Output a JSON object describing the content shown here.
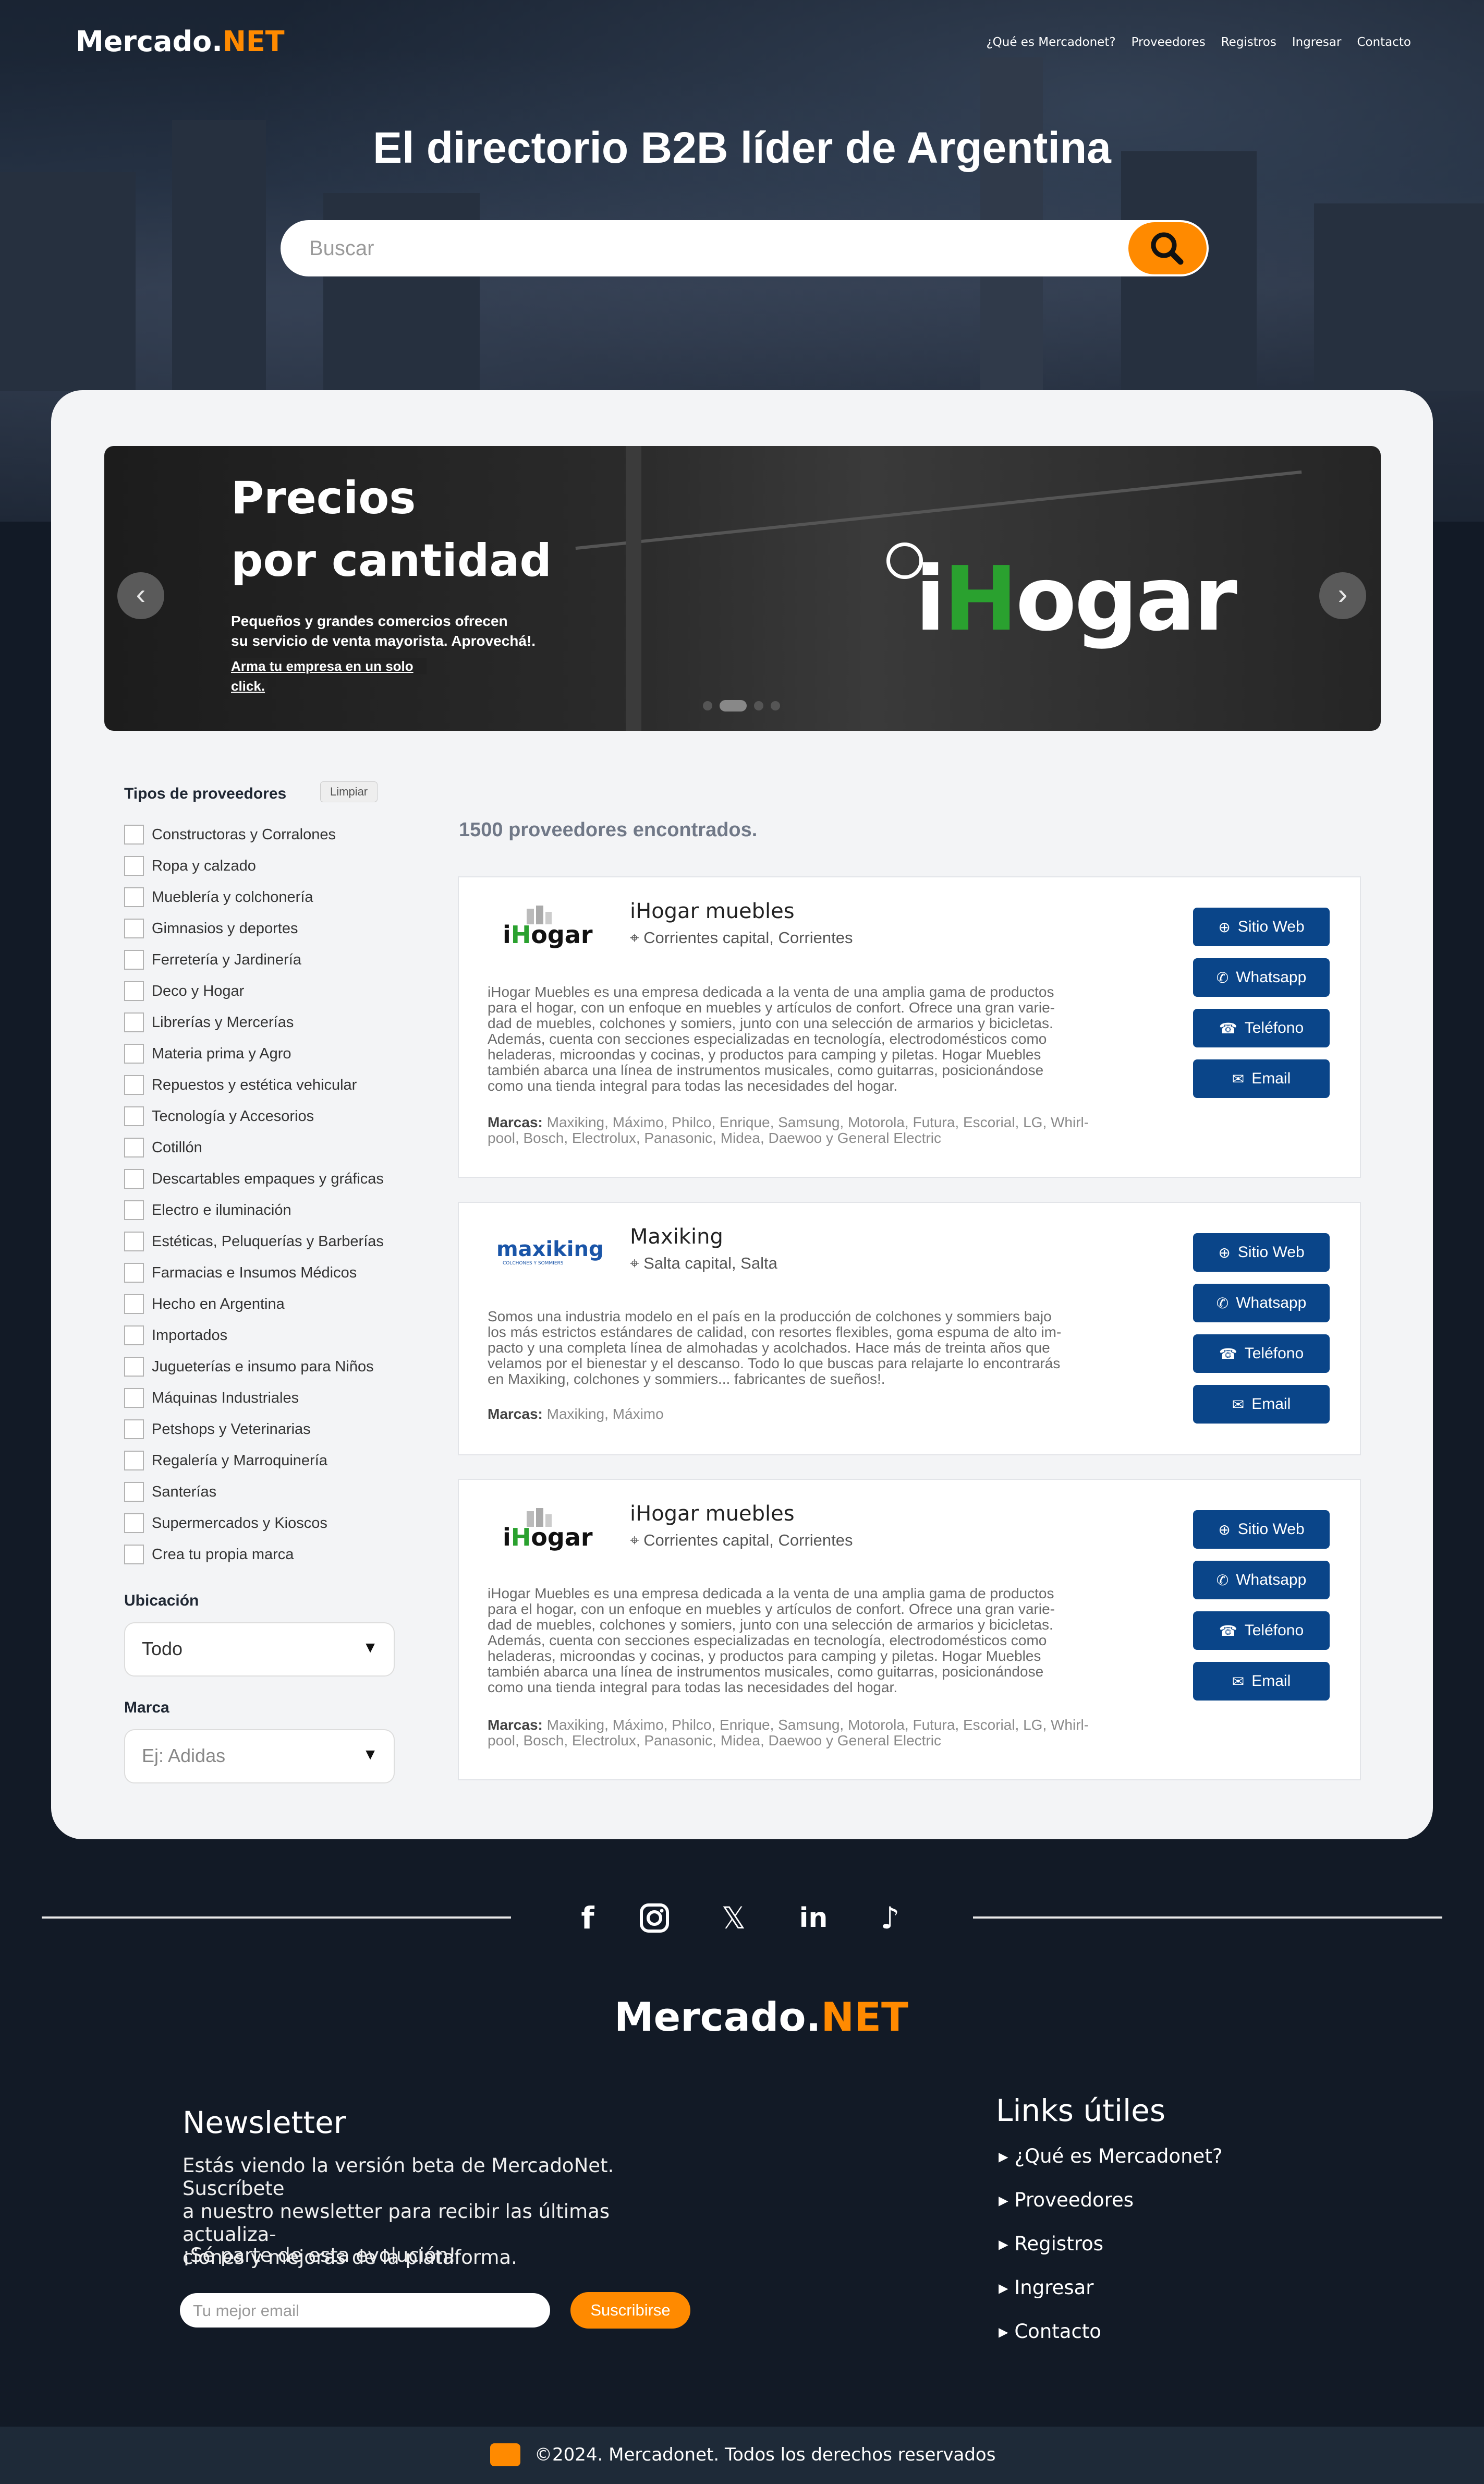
{
  "header": {
    "logo_main": "Mercado.",
    "logo_accent": "NET",
    "nav": [
      "¿Qué es Mercadonet?",
      "Proveedores",
      "Registros",
      "Ingresar",
      "Contacto"
    ]
  },
  "hero": {
    "title": "El directorio B2B líder de Argentina",
    "search_placeholder": "Buscar",
    "search_icon": "search-icon"
  },
  "banner": {
    "heading_1": "Precios",
    "heading_2": "por cantidad",
    "sub_1": "Pequeños y grandes comercios ofrecen",
    "sub_2": "su servicio de venta mayorista. Aprovechá!.",
    "cta_1": "Arma tu empresa en un solo",
    "cta_2": "click.",
    "brand_logo": "iHogar",
    "prev_icon": "chevron-left-icon",
    "next_icon": "chevron-right-icon"
  },
  "filters": {
    "title": "Tipos de proveedores",
    "clear_label": "Limpiar",
    "items": [
      "Constructoras y Corralones",
      "Ropa y calzado",
      "Mueblería y colchonería",
      "Gimnasios y deportes",
      "Ferretería y Jardinería",
      "Deco y Hogar",
      "Librerías y Mercerías",
      "Materia prima y Agro",
      "Repuestos y estética vehicular",
      "Tecnología y Accesorios",
      "Cotillón",
      "Descartables empaques y gráficas",
      "Electro e iluminación",
      "Estéticas, Peluquerías y Barberías",
      "Farmacias e Insumos Médicos",
      "Hecho en Argentina",
      "Importados",
      "Jugueterías e insumo para Niños",
      "Máquinas Industriales",
      "Petshops y Veterinarias",
      "Regalería y Marroquinería",
      "Santerías",
      "Supermercados y Kioscos",
      "Crea tu propia marca"
    ],
    "location_label": "Ubicación",
    "location_value": "Todo",
    "brand_label": "Marca",
    "brand_placeholder": "Ej: Adidas"
  },
  "results": {
    "count_text": "1500 proveedores encontrados.",
    "brands_label": "Marcas:",
    "buttons": {
      "web": "Sitio Web",
      "whatsapp": "Whatsapp",
      "phone": "Teléfono",
      "email": "Email"
    },
    "providers": [
      {
        "name": "iHogar muebles",
        "location": "Corrientes capital, Corrientes",
        "logo": "iHogar",
        "desc": [
          "iHogar Muebles es una empresa dedicada a la venta de una amplia gama de productos",
          "para el hogar, con un enfoque en muebles y artículos de confort. Ofrece una gran varie-",
          "dad de muebles, colchones y somiers, junto con una selección de armarios y bicicletas.",
          "Además, cuenta con secciones especializadas en tecnología, electrodomésticos como",
          "heladeras, microondas y cocinas, y productos para camping y piletas. Hogar Muebles",
          "también abarca una línea de instrumentos musicales, como guitarras, posicionándose",
          "como una tienda integral para todas las necesidades del hogar."
        ],
        "brands": [
          "Maxiking, Máximo, Philco, Enrique, Samsung, Motorola, Futura, Escorial, LG, Whirl-",
          "pool, Bosch, Electrolux, Panasonic, Midea, Daewoo y General Electric"
        ]
      },
      {
        "name": "Maxiking",
        "location": "Salta capital, Salta",
        "logo": "maxiking",
        "logo_sub": "COLCHONES Y SOMMIERS",
        "desc": [
          "Somos una industria modelo en el país en la producción de colchones y sommiers bajo",
          "los más estrictos estándares de calidad, con resortes flexibles, goma espuma de alto im-",
          "pacto y una completa línea de almohadas y acolchados. Hace más de treinta años que",
          "velamos por el bienestar y el descanso. Todo lo que buscas para relajarte lo encontrarás",
          "en Maxiking, colchones y sommiers... fabricantes de sueños!."
        ],
        "brands": [
          "Maxiking, Máximo"
        ]
      },
      {
        "name": "iHogar muebles",
        "location": "Corrientes capital, Corrientes",
        "logo": "iHogar",
        "desc": [
          "iHogar Muebles es una empresa dedicada a la venta de una amplia gama de productos",
          "para el hogar, con un enfoque en muebles y artículos de confort. Ofrece una gran varie-",
          "dad de muebles, colchones y somiers, junto con una selección de armarios y bicicletas.",
          "Además, cuenta con secciones especializadas en tecnología, electrodomésticos como",
          "heladeras, microondas y cocinas, y productos para camping y piletas. Hogar Muebles",
          "también abarca una línea de instrumentos musicales, como guitarras, posicionándose",
          "como una tienda integral para todas las necesidades del hogar."
        ],
        "brands": [
          "Maxiking, Máximo, Philco, Enrique, Samsung, Motorola, Futura, Escorial, LG, Whirl-",
          "pool, Bosch, Electrolux, Panasonic, Midea, Daewoo y General Electric"
        ]
      }
    ]
  },
  "footer": {
    "social_icons": [
      "facebook-icon",
      "instagram-icon",
      "x-icon",
      "linkedin-icon",
      "tiktok-icon"
    ],
    "newsletter_title": "Newsletter",
    "newsletter_text": [
      "Estás viendo la versión beta de MercadoNet. Suscríbete",
      "a nuestro newsletter para recibir las últimas actualiza-",
      "ciones y mejoras de la plataforma."
    ],
    "newsletter_cta": "¡Sé parte de esta evolución!",
    "email_placeholder": "Tu mejor email",
    "subscribe_label": "Suscribirse",
    "links_title": "Links útiles",
    "links": [
      "¿Qué es Mercadonet?",
      "Proveedores",
      "Registros",
      "Ingresar",
      "Contacto"
    ],
    "copyright": "©2024. Mercadonet. Todos los derechos reservados"
  },
  "colors": {
    "accent": "#ff8a00",
    "button_blue": "#0a4589",
    "dark_bg": "#121a26"
  }
}
